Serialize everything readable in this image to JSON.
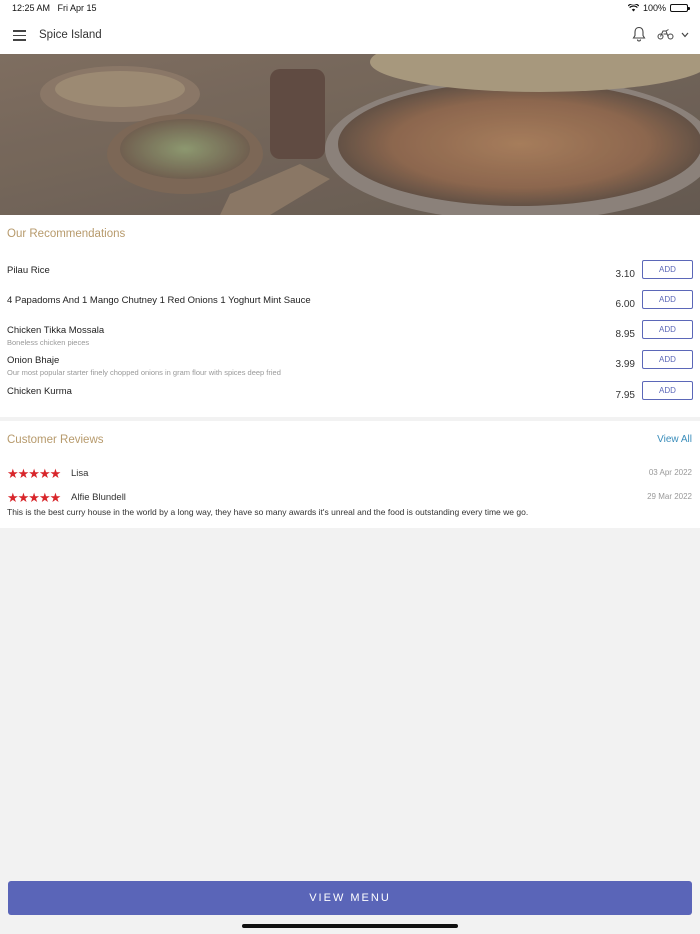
{
  "status_bar": {
    "time": "12:25 AM",
    "date": "Fri Apr 15",
    "battery": "100%"
  },
  "header": {
    "title": "Spice Island",
    "icons": [
      "menu-icon",
      "bell-icon",
      "scooter-icon",
      "chevron-down-icon"
    ]
  },
  "recommendations": {
    "title": "Our Recommendations",
    "add_label": "ADD",
    "items": [
      {
        "name": "Pilau Rice",
        "description": "",
        "price": "3.10"
      },
      {
        "name": "4 Papadoms And 1 Mango Chutney 1 Red Onions 1 Yoghurt Mint Sauce",
        "description": "",
        "price": "6.00"
      },
      {
        "name": "Chicken Tikka Mossala",
        "description": "Boneless chicken pieces",
        "price": "8.95"
      },
      {
        "name": "Onion Bhaje",
        "description": "Our most popular starter  finely chopped onions in gram flour with spices deep fried",
        "price": "3.99"
      },
      {
        "name": "Chicken Kurma",
        "description": "",
        "price": "7.95"
      }
    ]
  },
  "reviews": {
    "title": "Customer Reviews",
    "view_all": "View All",
    "items": [
      {
        "stars": "★★★★★",
        "rating": 5,
        "name": "Lisa",
        "date": "03 Apr 2022",
        "text": ""
      },
      {
        "stars": "★★★★★",
        "rating": 5,
        "name": "Alfie Blundell",
        "date": "29 Mar 2022",
        "text": "This is the best curry house in the world by a long way, they have so many awards it's unreal and the food is outstanding every time we go."
      }
    ]
  },
  "footer": {
    "view_menu": "VIEW MENU"
  },
  "colors": {
    "accent": "#5a65b8",
    "section_title": "#b79a6c",
    "link": "#3a8dbb",
    "stars": "#d8262b"
  }
}
